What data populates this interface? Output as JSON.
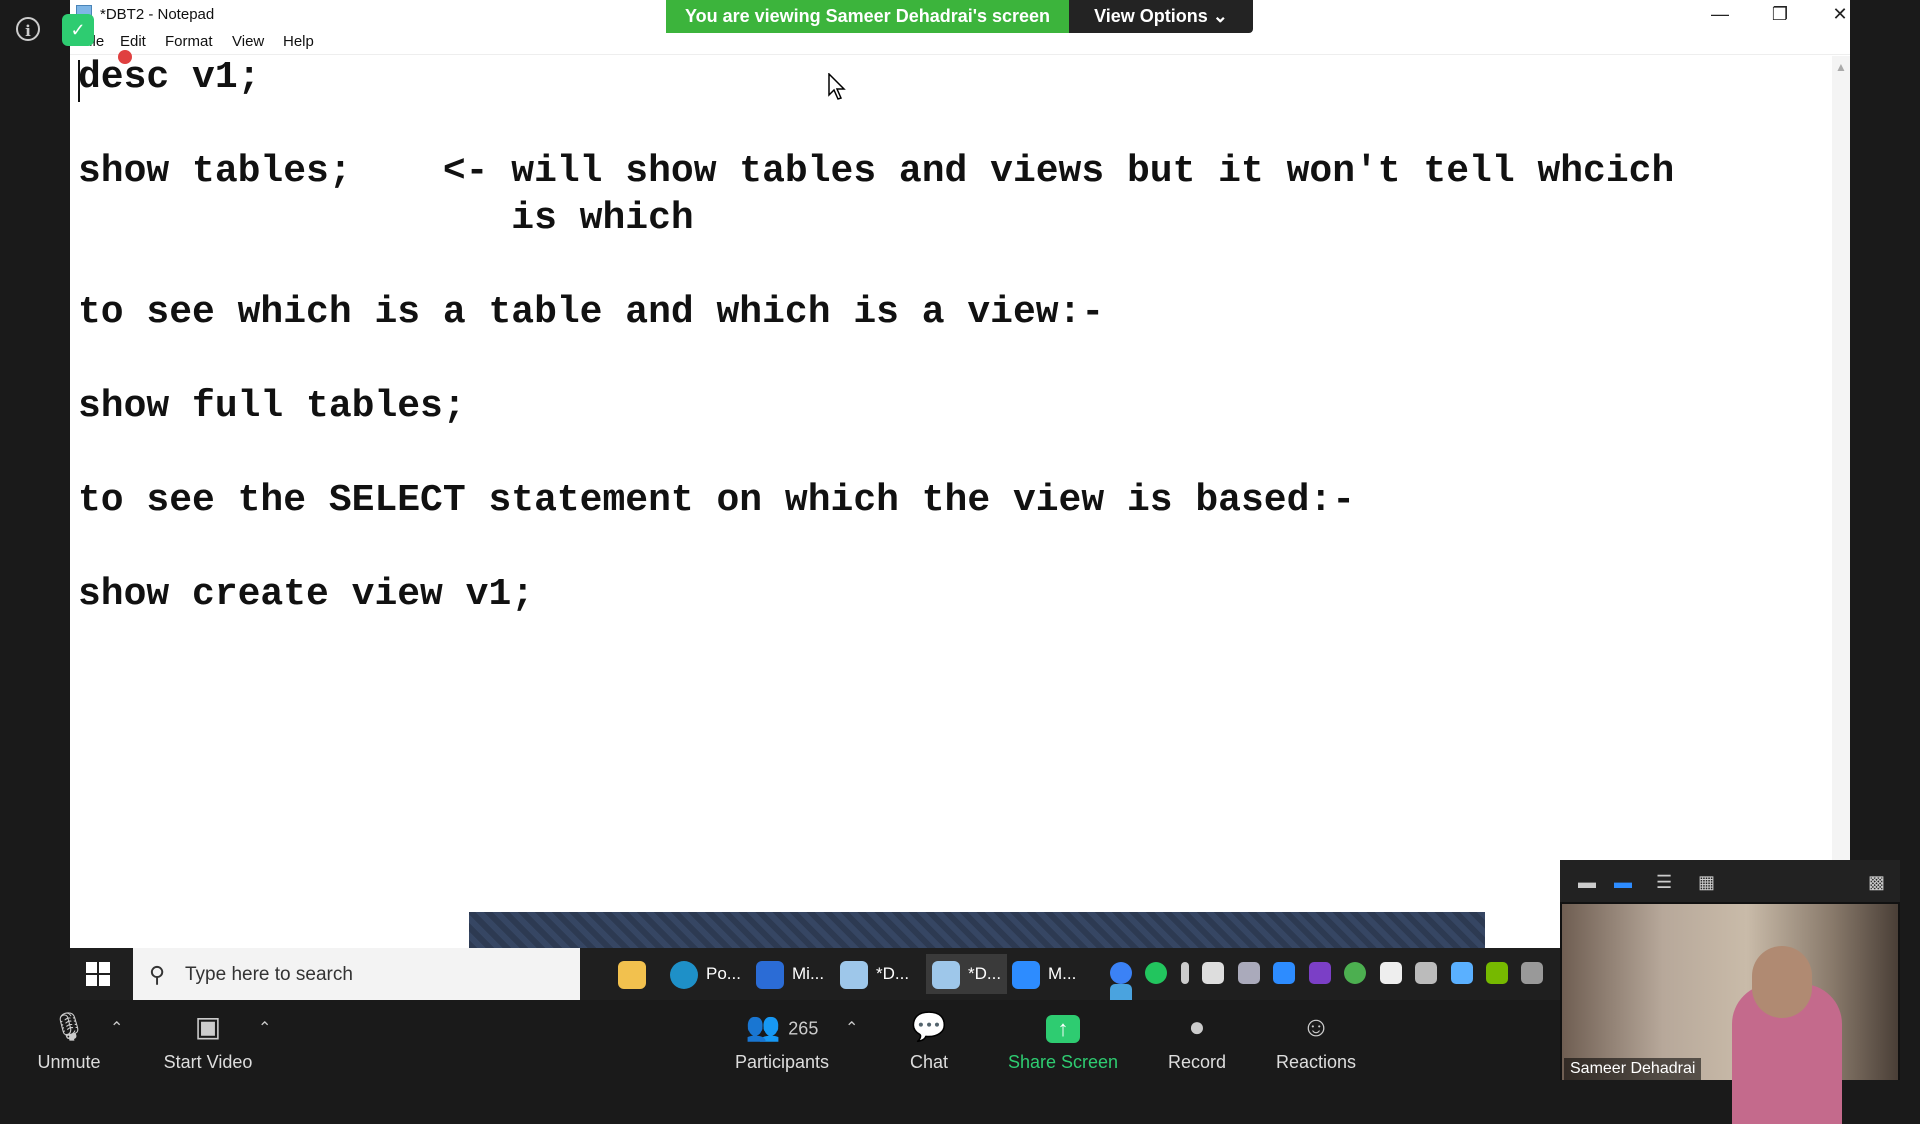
{
  "notepad": {
    "title": "*DBT2 - Notepad",
    "menu": [
      "File",
      "Edit",
      "Format",
      "View",
      "Help"
    ],
    "lines": [
      "desc v1;",
      "show tables;    <- will show tables and views but it won't tell whcich",
      "                   is which",
      "to see which is a table and which is a view:-",
      "show full tables;",
      "to see the SELECT statement on which the view is based:-",
      "show create view v1;"
    ]
  },
  "share_banner": {
    "text": "You are viewing Sameer Dehadrai's screen",
    "view_options": "View Options ⌄"
  },
  "taskbar": {
    "search_placeholder": "Type here to search",
    "apps": [
      "Po...",
      "Mi...",
      "*D...",
      "*D...",
      "M..."
    ]
  },
  "zoom_toolbar": {
    "unmute": "Unmute",
    "start_video": "Start Video",
    "participants": "Participants",
    "participant_count": "265",
    "chat": "Chat",
    "share_screen": "Share Screen",
    "record": "Record",
    "reactions": "Reactions"
  },
  "video": {
    "name": "Sameer Dehadrai"
  },
  "colors": {
    "share_green": "#3cb43c",
    "toolbar_bg": "#1a1a1a",
    "taskbar_bg": "#1f1f1f"
  }
}
